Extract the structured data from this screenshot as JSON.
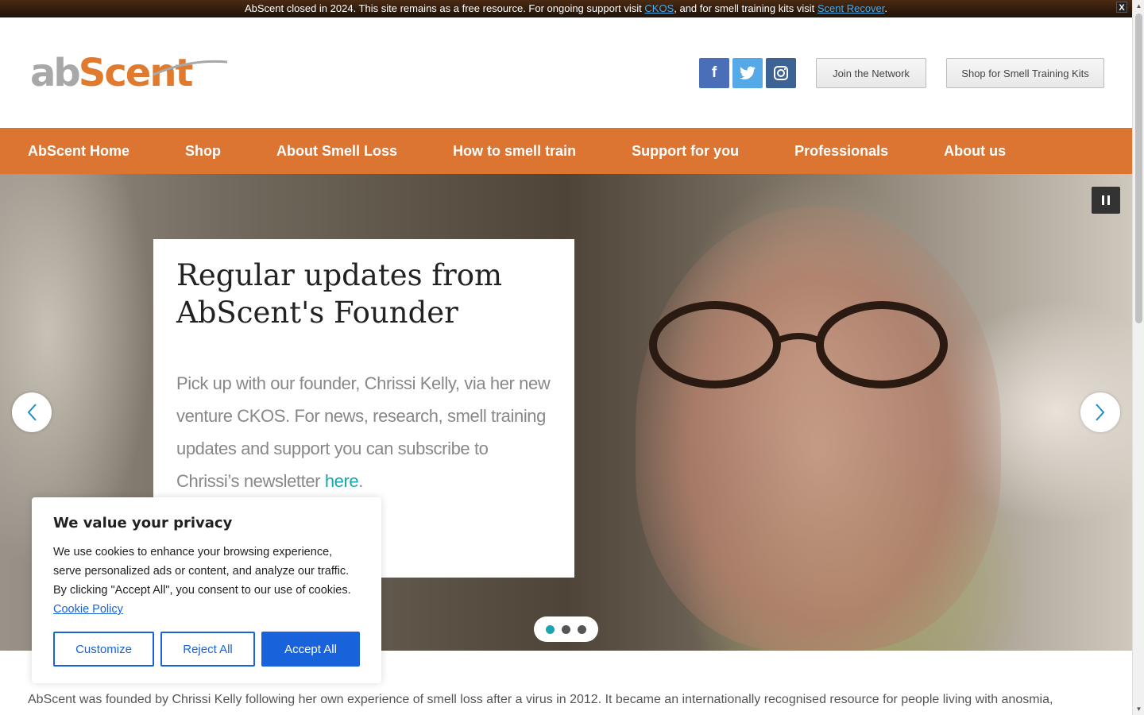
{
  "notice": {
    "text_before": "AbScent closed in 2024. This site remains as a free resource. For ongoing support visit ",
    "link1": "CKOS",
    "text_middle": ", and for smell training kits visit ",
    "link2": "Scent Recover",
    "text_after": ".",
    "close_label": "X"
  },
  "logo": {
    "part1": "ab",
    "part2": "Scent"
  },
  "social": {
    "facebook": "f",
    "twitter": "t",
    "instagram": "◎"
  },
  "header_buttons": {
    "join": "Join the Network",
    "shop": "Shop for Smell Training Kits"
  },
  "nav": [
    "AbScent Home",
    "Shop",
    "About Smell Loss",
    "How to smell train",
    "Support for you",
    "Professionals",
    "About us"
  ],
  "hero": {
    "pause_icon": "pause-icon",
    "title": "Regular updates from AbScent's Founder",
    "body": "Pick up with our founder, Chrissi Kelly, via her new venture CKOS. For news, research, smell training updates and support you can subscribe to Chrissi’s newsletter ",
    "link": "here",
    "body_end": ".",
    "prev_icon": "‹",
    "next_icon": "›",
    "slides": 3,
    "active_slide": 1
  },
  "intro": "AbScent was founded by Chrissi Kelly following her own experience of smell loss after a virus in 2012. It became an internationally recognised resource for people living with anosmia,",
  "cookie": {
    "title": "We value your privacy",
    "text": "We use cookies to enhance your browsing experience, serve personalized ads or content, and analyze our traffic. By clicking \"Accept All\", you consent to our use of cookies. ",
    "policy_link": "Cookie Policy",
    "customize": "Customize",
    "reject": "Reject All",
    "accept": "Accept All"
  },
  "colors": {
    "brand_orange": "#dc7532",
    "accent_blue": "#1863dc",
    "teal": "#1aa6b0"
  }
}
